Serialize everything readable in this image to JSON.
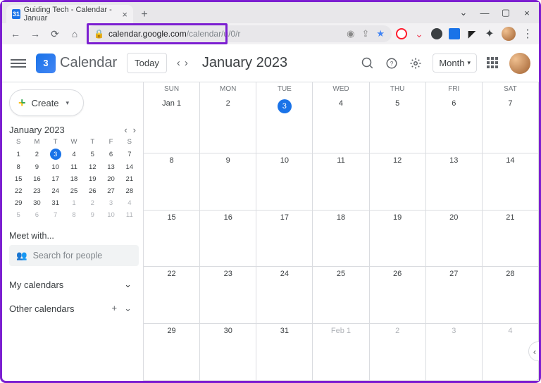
{
  "browser": {
    "tab_title": "Guiding Tech - Calendar - Januar",
    "url_host": "calendar.google.com",
    "url_path": "/calendar/u/0/r"
  },
  "header": {
    "app_name": "Calendar",
    "logo_date": "3",
    "today_label": "Today",
    "period_title": "January 2023",
    "view_label": "Month"
  },
  "sidebar": {
    "create_label": "Create",
    "mini_month": "January 2023",
    "dow": [
      "S",
      "M",
      "T",
      "W",
      "T",
      "F",
      "S"
    ],
    "meet_label": "Meet with...",
    "search_placeholder": "Search for people",
    "my_calendars": "My calendars",
    "other_calendars": "Other calendars",
    "mini": [
      [
        {
          "n": "1"
        },
        {
          "n": "2"
        },
        {
          "n": "3",
          "today": true
        },
        {
          "n": "4"
        },
        {
          "n": "5"
        },
        {
          "n": "6"
        },
        {
          "n": "7"
        }
      ],
      [
        {
          "n": "8"
        },
        {
          "n": "9"
        },
        {
          "n": "10"
        },
        {
          "n": "11"
        },
        {
          "n": "12"
        },
        {
          "n": "13"
        },
        {
          "n": "14"
        }
      ],
      [
        {
          "n": "15"
        },
        {
          "n": "16"
        },
        {
          "n": "17"
        },
        {
          "n": "18"
        },
        {
          "n": "19"
        },
        {
          "n": "20"
        },
        {
          "n": "21"
        }
      ],
      [
        {
          "n": "22"
        },
        {
          "n": "23"
        },
        {
          "n": "24"
        },
        {
          "n": "25"
        },
        {
          "n": "26"
        },
        {
          "n": "27"
        },
        {
          "n": "28"
        }
      ],
      [
        {
          "n": "29"
        },
        {
          "n": "30"
        },
        {
          "n": "31"
        },
        {
          "n": "1",
          "muted": true
        },
        {
          "n": "2",
          "muted": true
        },
        {
          "n": "3",
          "muted": true
        },
        {
          "n": "4",
          "muted": true
        }
      ],
      [
        {
          "n": "5",
          "muted": true
        },
        {
          "n": "6",
          "muted": true
        },
        {
          "n": "7",
          "muted": true
        },
        {
          "n": "8",
          "muted": true
        },
        {
          "n": "9",
          "muted": true
        },
        {
          "n": "10",
          "muted": true
        },
        {
          "n": "11",
          "muted": true
        }
      ]
    ]
  },
  "calendar": {
    "dow": [
      "SUN",
      "MON",
      "TUE",
      "WED",
      "THU",
      "FRI",
      "SAT"
    ],
    "weeks": [
      [
        {
          "n": "Jan 1"
        },
        {
          "n": "2"
        },
        {
          "n": "3",
          "today": true
        },
        {
          "n": "4"
        },
        {
          "n": "5"
        },
        {
          "n": "6"
        },
        {
          "n": "7"
        }
      ],
      [
        {
          "n": "8"
        },
        {
          "n": "9"
        },
        {
          "n": "10"
        },
        {
          "n": "11"
        },
        {
          "n": "12"
        },
        {
          "n": "13"
        },
        {
          "n": "14"
        }
      ],
      [
        {
          "n": "15"
        },
        {
          "n": "16"
        },
        {
          "n": "17"
        },
        {
          "n": "18"
        },
        {
          "n": "19"
        },
        {
          "n": "20"
        },
        {
          "n": "21"
        }
      ],
      [
        {
          "n": "22"
        },
        {
          "n": "23"
        },
        {
          "n": "24"
        },
        {
          "n": "25"
        },
        {
          "n": "26"
        },
        {
          "n": "27"
        },
        {
          "n": "28"
        }
      ],
      [
        {
          "n": "29"
        },
        {
          "n": "30"
        },
        {
          "n": "31"
        },
        {
          "n": "Feb 1",
          "muted": true
        },
        {
          "n": "2",
          "muted": true
        },
        {
          "n": "3",
          "muted": true
        },
        {
          "n": "4",
          "muted": true
        }
      ]
    ]
  }
}
